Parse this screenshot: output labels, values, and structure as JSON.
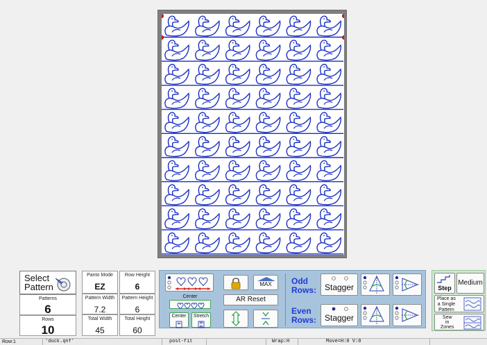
{
  "select_pattern": {
    "label_line1": "Select",
    "label_line2": "Pattern"
  },
  "stats": {
    "panto_mode": {
      "label": "Panto Mode",
      "value": "EZ"
    },
    "row_height": {
      "label": "Row Height",
      "value": "6"
    },
    "patterns": {
      "label": "Patterns",
      "value": "6"
    },
    "pattern_width": {
      "label": "Pattern Width",
      "value": "7.2"
    },
    "pattern_height": {
      "label": "Pattern Height",
      "value": "6"
    },
    "rows": {
      "label": "Rows",
      "value": "10"
    },
    "total_width": {
      "label": "Total Width",
      "value": "45"
    },
    "total_height": {
      "label": "Total Height",
      "value": "60"
    }
  },
  "controls": {
    "max_label": "MAX",
    "center_label": "Center",
    "ar_reset_label": "AR Reset",
    "center_small_label": "Center",
    "stretch_label": "Stretch"
  },
  "rows": {
    "odd_label_1": "Odd",
    "odd_label_2": "Rows:",
    "even_label_1": "Even",
    "even_label_2": "Rows:",
    "stagger_label": "Stagger"
  },
  "right": {
    "step_label": "Step",
    "medium_label": "Medium",
    "place_single_1": "Place as",
    "place_single_2": "a Single",
    "place_single_3": "Pattern",
    "sew_zones_1": "Sew",
    "sew_zones_2": "in",
    "sew_zones_3": "Zones"
  },
  "status": {
    "row": "Row:1",
    "file": "'duck.qnf'",
    "fit": "post-fit",
    "empty1": "",
    "wrap": "Wrap:H",
    "move": "Move=H:0 V:0",
    "empty2": ""
  },
  "canvas": {
    "pattern_name": "duck",
    "columns": 6,
    "rows": 10,
    "motif_color": "#1a2fc4"
  },
  "colors": {
    "panel_blue": "#a8c4dc",
    "panel_green": "#cfe6cf",
    "label_blue": "#1e3bd6",
    "lock_gold": "#e0a800"
  }
}
